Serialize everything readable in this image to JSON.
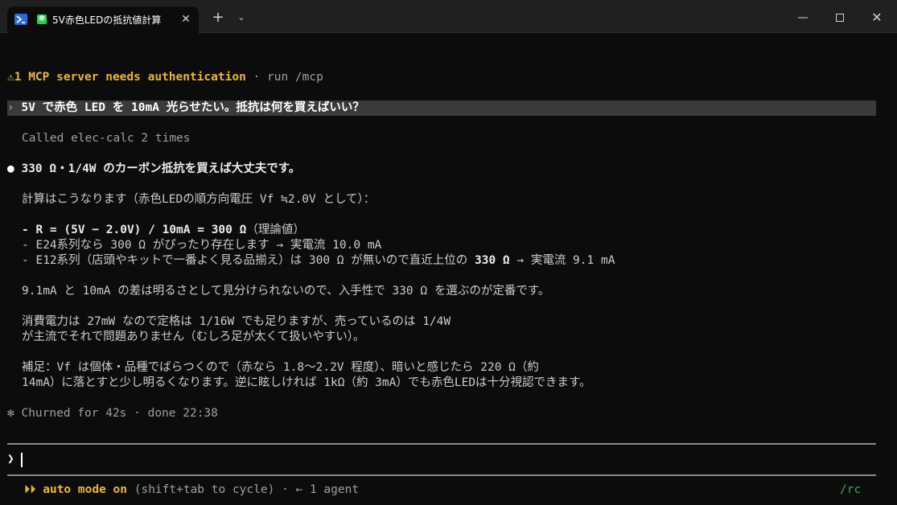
{
  "window": {
    "tab_title": "5V赤色LEDの抵抗値計算",
    "app_icon_glyph": "✱",
    "tab_close": "✕",
    "new_tab": "+",
    "dropdown": "⌄",
    "minimize": "—",
    "close": "✕"
  },
  "terminal": {
    "auth_warning_icon": "⚠",
    "auth_warning_text": "1 MCP server needs authentication",
    "auth_warning_hint": " · run /mcp",
    "prompt_marker": "›",
    "user_prompt": "5V で赤色 LED を 10mA 光らせたい。抵抗は何を買えばいい？",
    "tool_call": "Called elec-calc 2 times",
    "answer_bullet": "●",
    "answer_head": "330 Ω・1/4W のカーボン抵抗を買えば大丈夫です。",
    "calc_intro": "計算はこうなります（赤色LEDの順方向電圧 Vf ≒2.0V として）：",
    "calc_line1_bold": "- R = (5V − 2.0V) / 10mA = 300 Ω",
    "calc_line1_rest": "（理論値）",
    "calc_line2": "- E24系列なら 300 Ω がぴったり存在します → 実電流 10.0 mA",
    "calc_line3_a": "- E12系列（店頭やキットで一番よく見る品揃え）は 300 Ω が無いので直近上位の ",
    "calc_line3_b": "330 Ω",
    "calc_line3_c": " → 実電流 9.1 mA",
    "para1": "9.1mA と 10mA の差は明るさとして見分けられないので、入手性で 330 Ω を選ぶのが定番です。",
    "para2_l1": "消費電力は 27mW なので定格は 1/16W でも足りますが、売っているのは 1/4W",
    "para2_l2": "が主流でそれで問題ありません（むしろ足が太くて扱いやすい）。",
    "para3_l1": "補足：Vf は個体・品種でばらつくので（赤なら 1.8〜2.2V 程度）、暗いと感じたら 220 Ω（約",
    "para3_l2": "14mA）に落とすと少し明るくなります。逆に眩しければ 1kΩ（約 3mA）でも赤色LEDは十分視認できます。",
    "status": "✻ Churned for 42s · done 22:38",
    "input_prompt": "❯",
    "mode_arrows": "⏵⏵",
    "mode_label": "auto mode on",
    "mode_hint": " (shift+tab to cycle) · ← 1 agent",
    "rc_label": "/rc"
  },
  "colors": {
    "accent_amber": "#e8b830",
    "rc_green": "#2fb34a",
    "background": "#0c0c0c"
  }
}
